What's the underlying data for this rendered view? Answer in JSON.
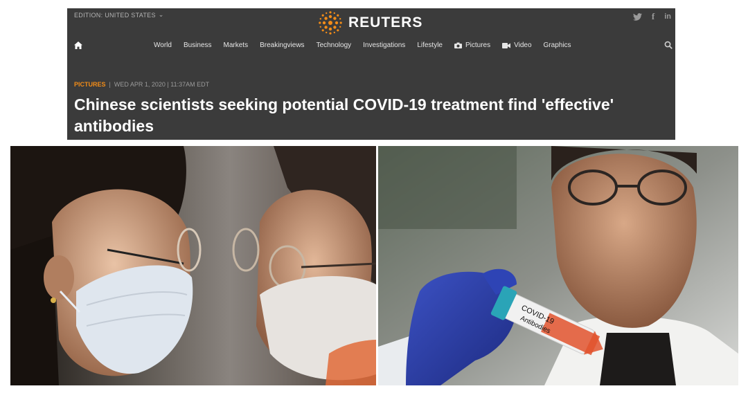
{
  "header": {
    "edition": "EDITION: UNITED STATES",
    "brand": "REUTERS",
    "social": [
      {
        "name": "twitter-icon",
        "glyph": "🐦"
      },
      {
        "name": "facebook-icon",
        "glyph": "f"
      },
      {
        "name": "linkedin-icon",
        "glyph": "in"
      }
    ]
  },
  "nav": {
    "items": [
      "World",
      "Business",
      "Markets",
      "Breakingviews",
      "Technology",
      "Investigations",
      "Lifestyle",
      "Pictures",
      "Video",
      "Graphics"
    ]
  },
  "article": {
    "category": "PICTURES",
    "separator": "|",
    "date": "WED APR 1, 2020 | 11:37AM EDT",
    "headline": "Chinese scientists seeking potential COVID-19 treatment find 'effective' antibodies"
  },
  "photos": {
    "right": {
      "tube_label_line1": "COVID-19",
      "tube_label_line2": "Antibodies"
    }
  },
  "colors": {
    "header_bg": "#3b3b3b",
    "accent": "#f28c18",
    "glove": "#2c3fa0"
  }
}
